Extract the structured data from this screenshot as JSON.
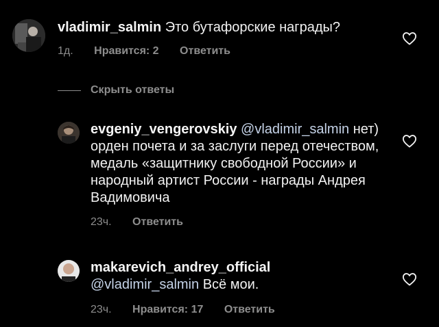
{
  "comments": [
    {
      "username": "vladimir_salmin",
      "mention": "",
      "text": "Это бутафорские награды?",
      "time": "1д.",
      "likes": "Нравится: 2",
      "reply": "Ответить"
    },
    {
      "username": "evgeniy_vengerovskiy",
      "mention": "@vladimir_salmin",
      "text": "нет) орден почета и за заслуги перед отечеством, медаль «защитнику свободной России» и народный артист России - награды Андрея Вадимовича",
      "time": "23ч.",
      "likes": "",
      "reply": "Ответить"
    },
    {
      "username": "makarevich_andrey_official",
      "mention": "@vladimir_salmin",
      "text": "Всё мои.",
      "time": "23ч.",
      "likes": "Нравится: 17",
      "reply": "Ответить"
    }
  ],
  "hide_replies_label": "Скрыть ответы",
  "colors": {
    "background": "#000000",
    "text": "#f2f2f2",
    "meta": "#8e8e8e",
    "mention": "#c5d3e8"
  },
  "icons": {
    "like": "heart-outline-icon"
  }
}
